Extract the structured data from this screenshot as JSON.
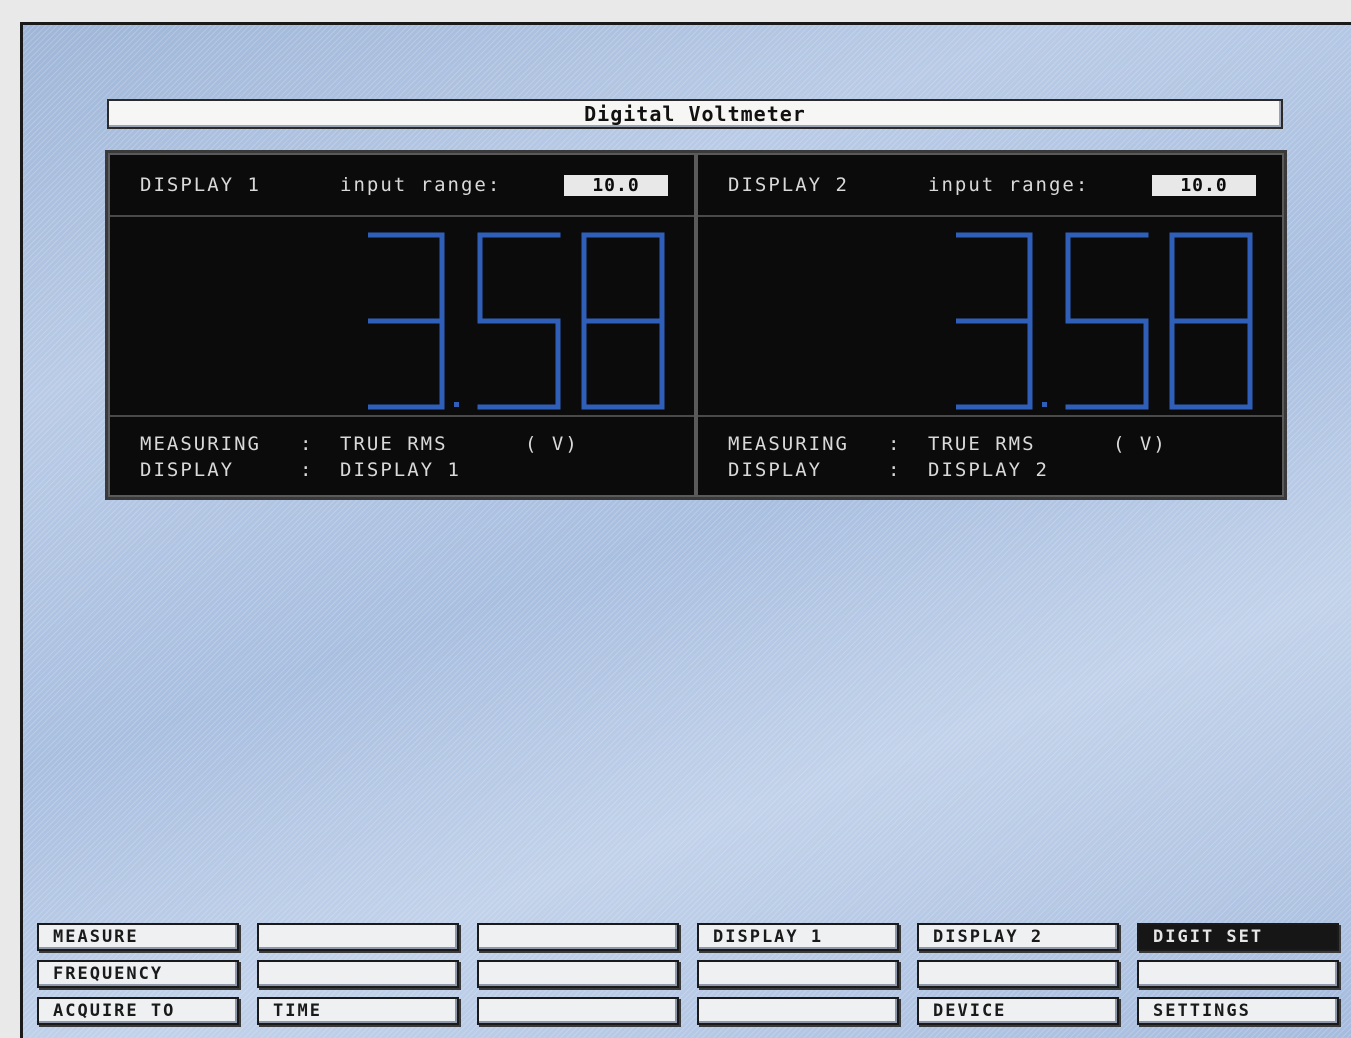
{
  "app": {
    "title": "Digital Voltmeter"
  },
  "displays": [
    {
      "label": "DISPLAY 1",
      "range_label": "input range:",
      "range_value": "10.0",
      "reading": "3.58",
      "measuring_label": "MEASURING",
      "measuring_value": "TRUE RMS",
      "unit": "( V)",
      "display_label": "DISPLAY",
      "display_value": "DISPLAY 1",
      "separator": ":"
    },
    {
      "label": "DISPLAY 2",
      "range_label": "input range:",
      "range_value": "10.0",
      "reading": "3.58",
      "measuring_label": "MEASURING",
      "measuring_value": "TRUE RMS",
      "unit": "( V)",
      "display_label": "DISPLAY",
      "display_value": "DISPLAY 2",
      "separator": ":"
    }
  ],
  "softkeys": {
    "row1": [
      "MEASURE",
      "",
      "",
      "DISPLAY 1",
      "DISPLAY 2",
      "DIGIT SET"
    ],
    "row2": [
      "FREQUENCY",
      "",
      "",
      "",
      "",
      ""
    ],
    "row3": [
      "ACQUIRE TO",
      "TIME",
      "",
      "",
      "DEVICE",
      "SETTINGS"
    ],
    "active": "DIGIT SET"
  },
  "colors": {
    "digit": "#2f5fb8",
    "panel_bg": "#0b0b0b",
    "screen_bg": "#b0c4e2"
  }
}
